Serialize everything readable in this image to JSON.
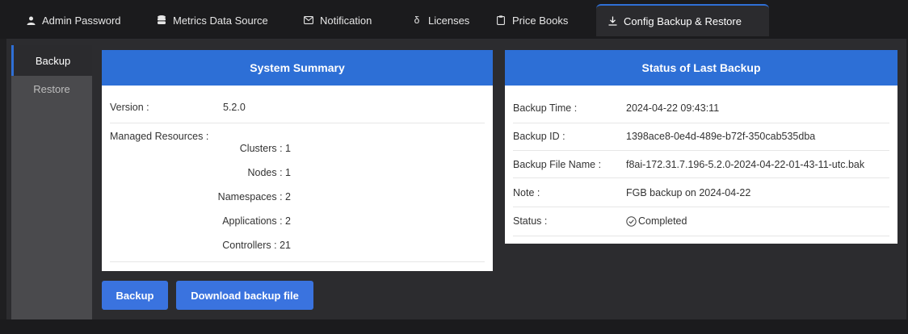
{
  "tabs": [
    {
      "label": "Admin Password",
      "icon": "user-icon",
      "active": false
    },
    {
      "label": "Metrics Data Source",
      "icon": "database-icon",
      "active": false
    },
    {
      "label": "Notification",
      "icon": "mail-icon",
      "active": false
    },
    {
      "label": "Licenses",
      "icon": "license-icon",
      "active": false
    },
    {
      "label": "Price Books",
      "icon": "clipboard-icon",
      "active": false
    },
    {
      "label": "Config Backup & Restore",
      "icon": "download-icon",
      "active": true
    }
  ],
  "sidenav": [
    {
      "label": "Backup",
      "active": true
    },
    {
      "label": "Restore",
      "active": false
    }
  ],
  "summary": {
    "title": "System Summary",
    "version_label": "Version :",
    "version_value": "5.2.0",
    "resources_label": "Managed Resources :",
    "resources": [
      "Clusters : 1",
      "Nodes : 1",
      "Namespaces : 2",
      "Applications : 2",
      "Controllers : 21"
    ]
  },
  "status": {
    "title": "Status of Last Backup",
    "rows": [
      {
        "label": "Backup Time :",
        "value": "2024-04-22 09:43:11"
      },
      {
        "label": "Backup ID :",
        "value": "1398ace8-0e4d-489e-b72f-350cab535dba"
      },
      {
        "label": "Backup File Name :",
        "value": "f8ai-172.31.7.196-5.2.0-2024-04-22-01-43-11-utc.bak"
      },
      {
        "label": "Note :",
        "value": "FGB backup on 2024-04-22"
      },
      {
        "label": "Status :",
        "value": "Completed",
        "icon": "check-circle-icon"
      }
    ]
  },
  "buttons": {
    "backup": "Backup",
    "download": "Download backup file"
  },
  "colors": {
    "accent": "#2d6fd6",
    "button": "#3a73df",
    "background": "#2c2c2f"
  }
}
